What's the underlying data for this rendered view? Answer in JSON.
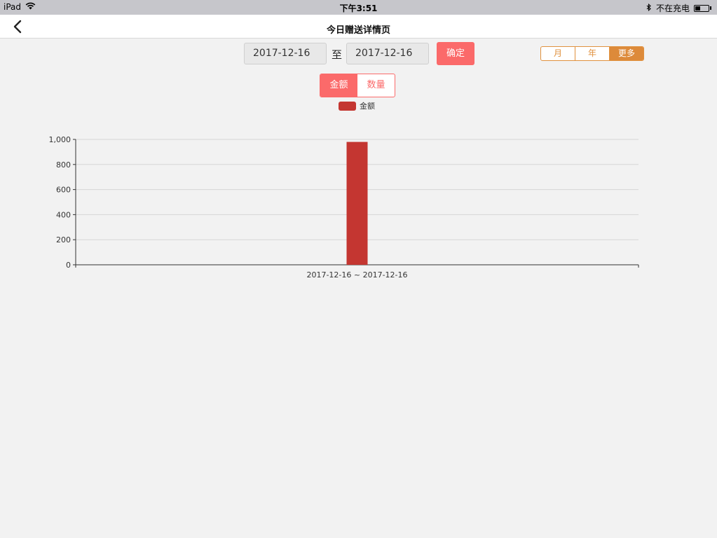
{
  "status_bar": {
    "device": "iPad",
    "time": "下午3:51",
    "charging": "不在充电",
    "battery_level": 0.4
  },
  "nav": {
    "title": "今日赠送详情页"
  },
  "filters": {
    "start_date": "2017-12-16",
    "separator": "至",
    "end_date": "2017-12-16",
    "confirm_label": "确定",
    "periods": [
      {
        "label": "月",
        "active": false
      },
      {
        "label": "年",
        "active": false
      },
      {
        "label": "更多",
        "active": true
      }
    ]
  },
  "metric_toggle": [
    {
      "label": "金额",
      "active": true
    },
    {
      "label": "数量",
      "active": false
    }
  ],
  "colors": {
    "accent": "#fb6a6a",
    "period_accent": "#dd8a3a",
    "bar": "#c43631"
  },
  "chart_data": {
    "type": "bar",
    "categories": [
      "2017-12-16 ~ 2017-12-16"
    ],
    "series": [
      {
        "name": "金额",
        "values": [
          980
        ]
      }
    ],
    "yticks": [
      "0",
      "200",
      "400",
      "600",
      "800",
      "1,000"
    ],
    "ylim": [
      0,
      1000
    ],
    "grid": true,
    "legend": "top-center"
  }
}
